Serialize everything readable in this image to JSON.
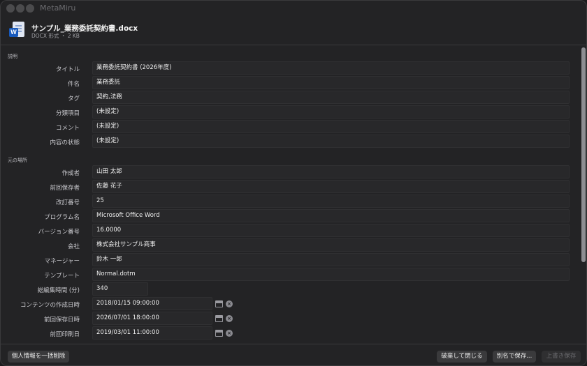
{
  "app": {
    "title": "MetaMiru"
  },
  "file": {
    "name": "サンプル_業務委託契約書.docx",
    "meta": "DOCX 形式 ・ 2 KB",
    "icon": "word-document-icon",
    "badge": "W"
  },
  "sections": {
    "description": "説明",
    "origin": "元の場所"
  },
  "rows": [
    {
      "label": "タイトル",
      "value": "業務委託契約書 (2026年度)"
    },
    {
      "label": "件名",
      "value": "業務委託"
    },
    {
      "label": "タグ",
      "value": "契約,法務"
    },
    {
      "label": "分類項目",
      "value": "(未設定)"
    },
    {
      "label": "コメント",
      "value": "(未設定)"
    },
    {
      "label": "内容の状態",
      "value": "(未設定)"
    },
    {
      "label": "作成者",
      "value": "山田 太郎"
    },
    {
      "label": "前回保存者",
      "value": "佐藤 花子"
    },
    {
      "label": "改訂番号",
      "value": "25"
    },
    {
      "label": "プログラム名",
      "value": "Microsoft Office Word"
    },
    {
      "label": "バージョン番号",
      "value": "16.0000"
    },
    {
      "label": "会社",
      "value": "株式会社サンプル商事"
    },
    {
      "label": "マネージャー",
      "value": "鈴木 一郎"
    },
    {
      "label": "テンプレート",
      "value": "Normal.dotm"
    },
    {
      "label": "総編集時間 (分)",
      "value": "340"
    },
    {
      "label": "コンテンツの作成日時",
      "value": "2018/01/15 09:00:00"
    },
    {
      "label": "前回保存日時",
      "value": "2026/07/01 18:00:00"
    },
    {
      "label": "前回印刷日",
      "value": "2019/03/01 11:00:00"
    }
  ],
  "footer": {
    "remove_personal": "個人情報を一括削除",
    "discard_close": "破棄して閉じる",
    "save_as": "別名で保存...",
    "overwrite": "上書き保存"
  },
  "icons": {
    "calendar": "calendar-icon",
    "clear": "clear-icon"
  },
  "colors": {
    "background": "#232325",
    "field": "#28282a",
    "accent": "#185abd"
  }
}
